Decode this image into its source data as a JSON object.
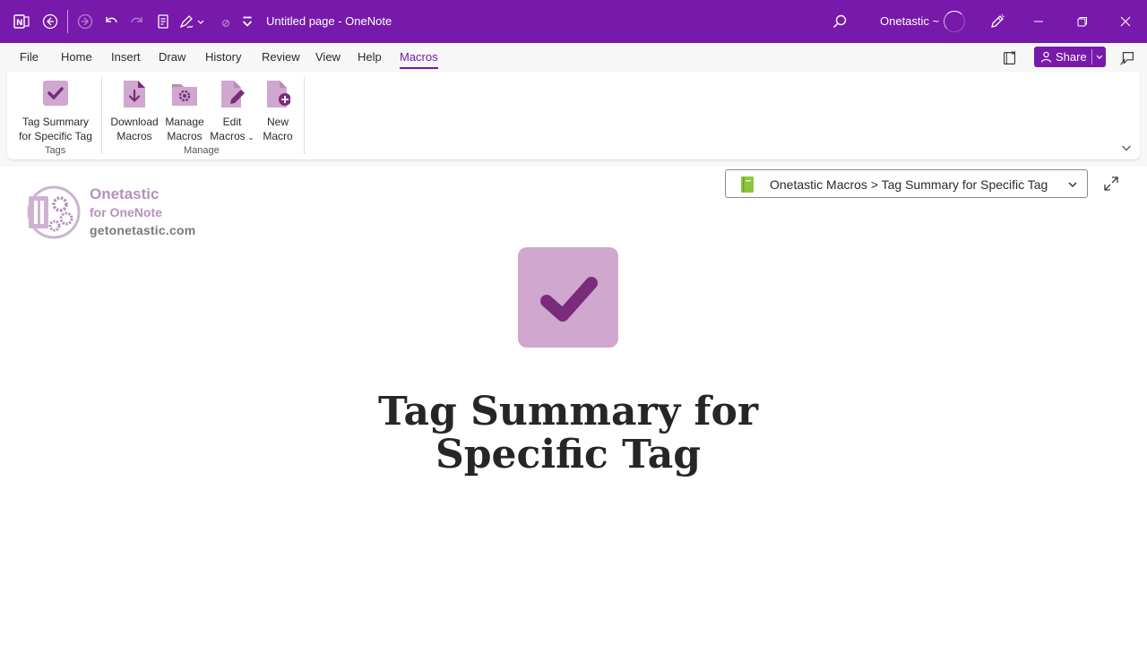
{
  "titlebar": {
    "title": "Untitled page  -  OneNote",
    "user": "Onetastic ~"
  },
  "ribbon": {
    "tabs": [
      {
        "label": "File"
      },
      {
        "label": "Home"
      },
      {
        "label": "Insert"
      },
      {
        "label": "Draw"
      },
      {
        "label": "History"
      },
      {
        "label": "Review"
      },
      {
        "label": "View"
      },
      {
        "label": "Help"
      },
      {
        "label": "Macros"
      }
    ],
    "active_tab": "Macros",
    "share_label": "Share",
    "buttons": {
      "tag_summary": {
        "line1": "Tag Summary",
        "line2": "for Specific Tag"
      },
      "download": {
        "line1": "Download",
        "line2": "Macros"
      },
      "manage": {
        "line1": "Manage",
        "line2": "Macros"
      },
      "edit": {
        "line1": "Edit",
        "line2": "Macros"
      },
      "new": {
        "line1": "New",
        "line2": "Macro"
      }
    },
    "groups": {
      "tags": "Tags",
      "manage": "Manage"
    }
  },
  "page": {
    "logo": {
      "line1": "Onetastic",
      "line2": "for OneNote",
      "line3": "getonetastic.com"
    },
    "breadcrumb": "Onetastic Macros > Tag Summary for Specific Tag",
    "title_line1": "Tag Summary for",
    "title_line2": "Specific Tag"
  },
  "colors": {
    "brand": "#7719aa",
    "macro_icon": "#cfa7cf",
    "macro_icon_dark": "#7a2b7a",
    "notebook": "#8cc63f"
  }
}
